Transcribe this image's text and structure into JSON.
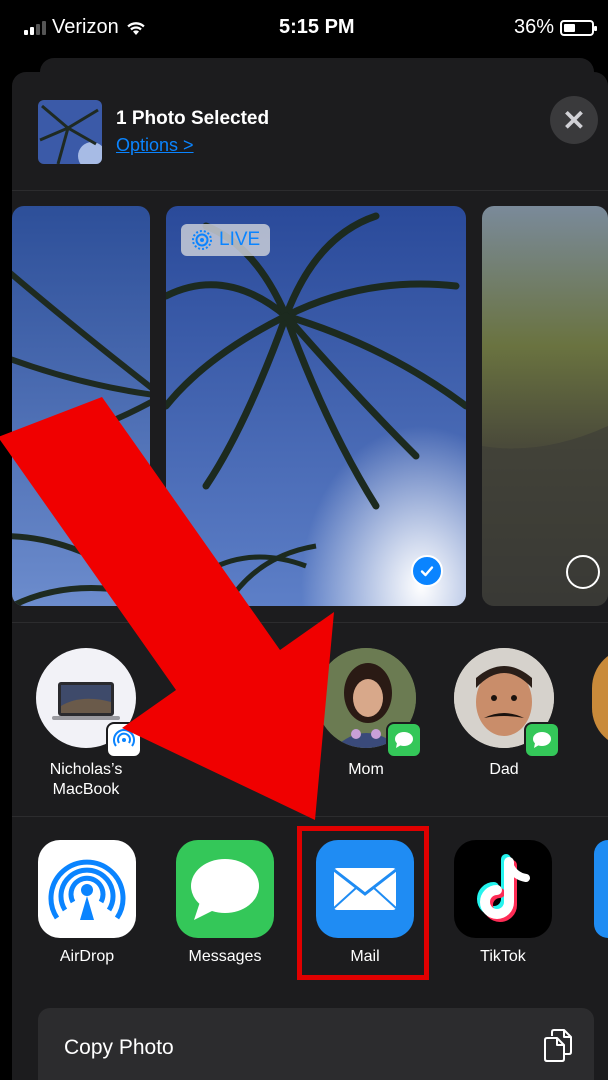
{
  "status_bar": {
    "carrier": "Verizon",
    "time": "5:15 PM",
    "battery": "36%",
    "battery_level": 0.36
  },
  "header": {
    "title": "1 Photo Selected",
    "options_label": "Options >"
  },
  "photos": {
    "live_label": "LIVE",
    "selected_index": 1
  },
  "people": [
    {
      "name": "Nicholas’s\nMacBook",
      "line1": "Nicholas’s",
      "line2": "MacBook",
      "badge": "airdrop-icon"
    },
    {
      "name": "Mom",
      "badge": "messages-icon"
    },
    {
      "name": "Dad",
      "badge": "messages-icon"
    }
  ],
  "apps": [
    {
      "label": "AirDrop",
      "icon": "airdrop-icon"
    },
    {
      "label": "Messages",
      "icon": "messages-icon"
    },
    {
      "label": "Mail",
      "icon": "mail-icon"
    },
    {
      "label": "TikTok",
      "icon": "tiktok-icon"
    }
  ],
  "actions": [
    {
      "label": "Copy Photo",
      "icon": "copy-icon"
    }
  ],
  "colors": {
    "sheet": "#1c1c1e",
    "accent": "#0a84ff",
    "annotation": "#e00000",
    "messages_green": "#34c759"
  }
}
